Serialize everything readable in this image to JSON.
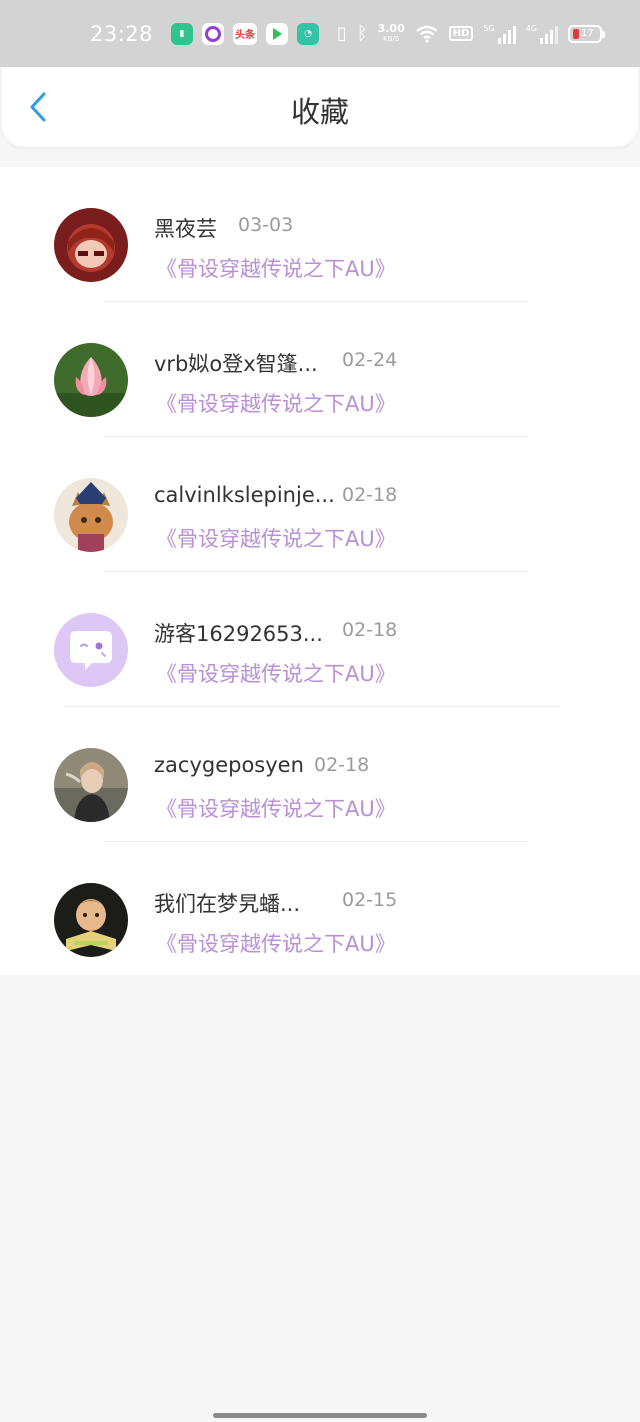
{
  "status_bar": {
    "time": "23:28",
    "speed_value": "3.00",
    "speed_unit": "KB/S",
    "hd_label": "HD",
    "net1_label": "5G",
    "net2_label": "4G",
    "battery_level": "17",
    "news_app_label": "头条"
  },
  "header": {
    "title": "收藏",
    "back_icon": "chevron-left-icon",
    "accent_color": "#2e9be8"
  },
  "favorites": [
    {
      "name": "黑夜芸",
      "date": "03-03",
      "work": "《骨设穿越传说之下AU》",
      "avatar": "anime-character-avatar"
    },
    {
      "name": "vrb姒o登x智篷...",
      "date": "02-24",
      "work": "《骨设穿越传说之下AU》",
      "avatar": "lotus-flower-avatar"
    },
    {
      "name": "calvinlkslepinje...",
      "date": "02-18",
      "work": "《骨设穿越传说之下AU》",
      "avatar": "cat-with-hat-avatar"
    },
    {
      "name": "游客16292653...",
      "date": "02-18",
      "work": "《骨设穿越传说之下AU》",
      "avatar": "chat-bubble-default-avatar"
    },
    {
      "name": "zacygeposyen",
      "date": "02-18",
      "work": "《骨设穿越传说之下AU》",
      "avatar": "girl-photo-avatar"
    },
    {
      "name": "我们在梦旯蟠...",
      "date": "02-15",
      "work": "《骨设穿越传说之下AU》",
      "avatar": "child-reading-avatar"
    }
  ],
  "colors": {
    "link_purple": "#b98fd6",
    "date_gray": "#9b9b9b",
    "default_avatar_bg": "#dcc7f5"
  }
}
